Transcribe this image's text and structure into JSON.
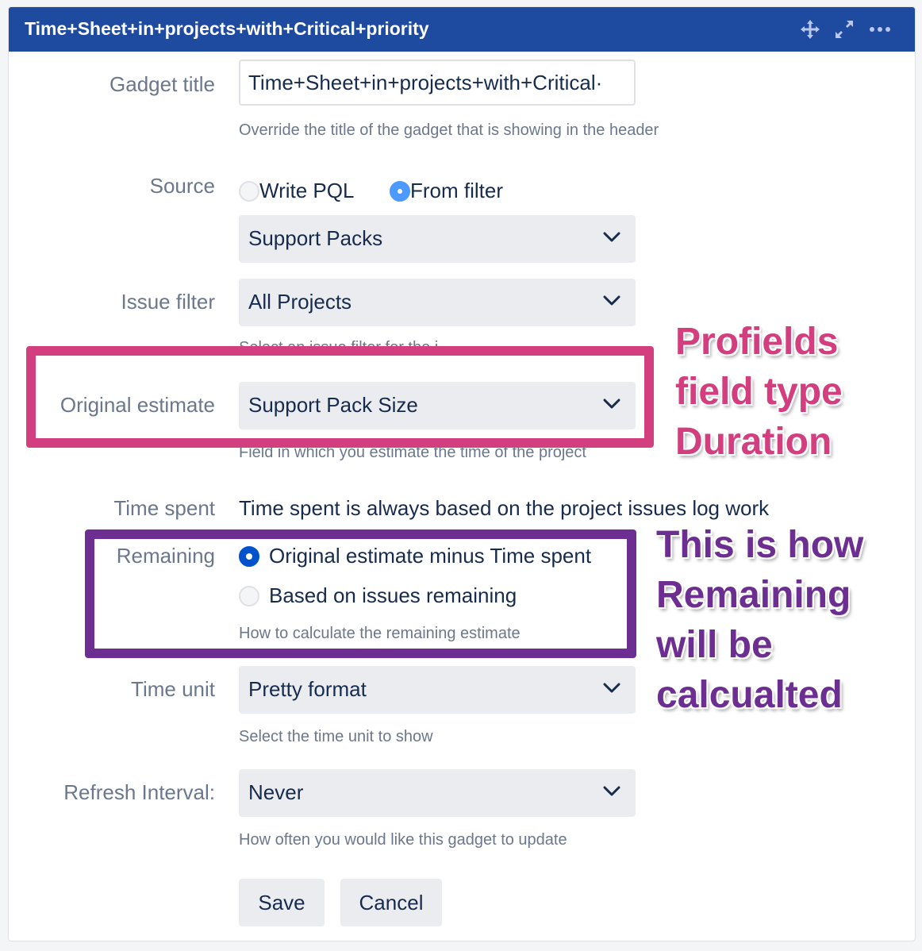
{
  "gadget": {
    "title": "Time+Sheet+in+projects+with+Critical+priority",
    "icons": [
      "move-icon",
      "expand-icon",
      "more-icon"
    ]
  },
  "form": {
    "gadget_title": {
      "label": "Gadget title",
      "value": "Time+Sheet+in+projects+with+Critical·",
      "help": "Override the title of the gadget that is showing in the header"
    },
    "source": {
      "label": "Source",
      "options": [
        "Write PQL",
        "From filter"
      ],
      "selected": "From filter",
      "filter_value": "Support Packs"
    },
    "issue_filter": {
      "label": "Issue filter",
      "value": "All Projects",
      "help_fragment": "Select an issue filter for the i..."
    },
    "original_estimate": {
      "label": "Original estimate",
      "value": "Support Pack Size",
      "help": "Field in which you estimate the time of the project"
    },
    "time_spent": {
      "label": "Time spent",
      "text": "Time spent is always based on the project issues log work"
    },
    "remaining": {
      "label": "Remaining",
      "options": [
        "Original estimate minus Time spent",
        "Based on issues remaining"
      ],
      "selected": "Original estimate minus Time spent",
      "help": "How to calculate the remaining estimate"
    },
    "time_unit": {
      "label": "Time unit",
      "value": "Pretty format",
      "help": "Select the time unit to show"
    },
    "refresh_interval": {
      "label": "Refresh Interval:",
      "value": "Never",
      "help": "How often you would like this gadget to update"
    },
    "buttons": {
      "save": "Save",
      "cancel": "Cancel"
    }
  },
  "annotations": {
    "profields": [
      "Profields",
      "field type",
      "Duration"
    ],
    "remaining": [
      "This is how",
      "Remaining",
      "will be",
      "calcualted"
    ],
    "colors": {
      "pink": "#d33f7e",
      "purple": "#6d2e91"
    }
  },
  "colors": {
    "header": "#1e4aa0",
    "label": "#6b778c",
    "text": "#172b4d",
    "select_bg": "#ebecf0",
    "radio_on": "#0052cc"
  }
}
